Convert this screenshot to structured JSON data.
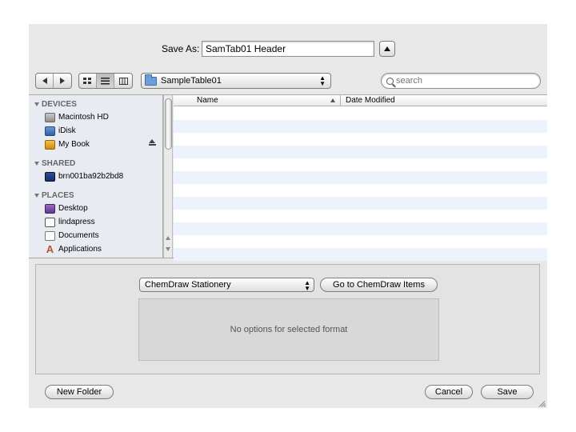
{
  "save_as": {
    "label": "Save As:",
    "value": "SamTab01 Header"
  },
  "location": {
    "folder": "SampleTable01"
  },
  "search": {
    "placeholder": "search"
  },
  "sidebar": {
    "sections": [
      {
        "title": "DEVICES",
        "items": [
          {
            "label": "Macintosh HD",
            "icon": "hard-drive-icon"
          },
          {
            "label": "iDisk",
            "icon": "idisk-icon"
          },
          {
            "label": "My Book",
            "icon": "external-drive-icon",
            "ejectable": true
          }
        ]
      },
      {
        "title": "SHARED",
        "items": [
          {
            "label": "brn001ba92b2bd8",
            "icon": "network-computer-icon"
          }
        ]
      },
      {
        "title": "PLACES",
        "items": [
          {
            "label": "Desktop",
            "icon": "desktop-icon"
          },
          {
            "label": "lindapress",
            "icon": "home-icon"
          },
          {
            "label": "Documents",
            "icon": "documents-icon"
          },
          {
            "label": "Applications",
            "icon": "applications-icon"
          }
        ]
      }
    ]
  },
  "file_list": {
    "columns": [
      "Name",
      "Date Modified"
    ]
  },
  "format": {
    "selected": "ChemDraw Stationery",
    "goto_label": "Go to ChemDraw Items",
    "options_message": "No options for selected format"
  },
  "buttons": {
    "new_folder": "New Folder",
    "cancel": "Cancel",
    "save": "Save"
  }
}
